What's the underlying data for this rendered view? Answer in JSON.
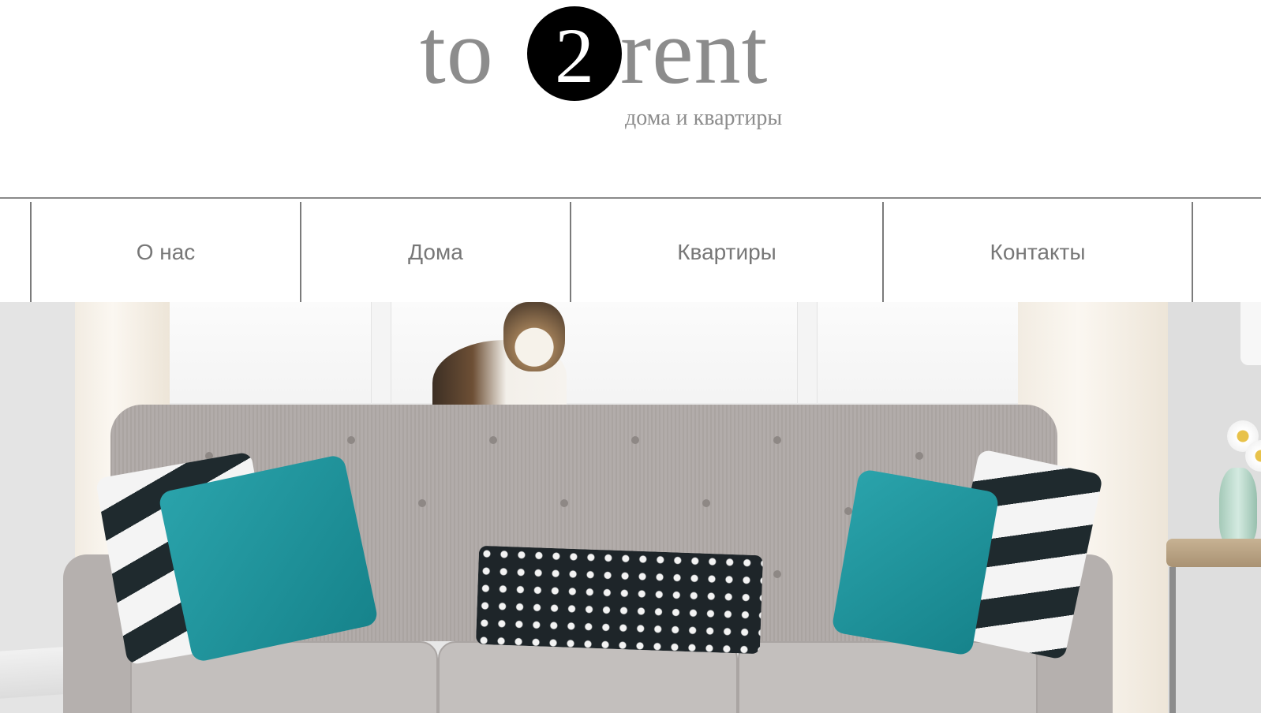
{
  "brand": {
    "logo_left": "to",
    "logo_digit": "2",
    "logo_right": "rent",
    "tagline": "дома и квартиры",
    "text_color": "#8c8c8c",
    "circle_color": "#000000"
  },
  "nav": {
    "items": [
      {
        "label": "О нас"
      },
      {
        "label": "Дома"
      },
      {
        "label": "Квартиры"
      },
      {
        "label": "Контакты"
      }
    ],
    "text_color": "#777777",
    "divider_color": "#7b7b7b"
  },
  "hero": {
    "image_description_icon": "living-room-photo"
  }
}
